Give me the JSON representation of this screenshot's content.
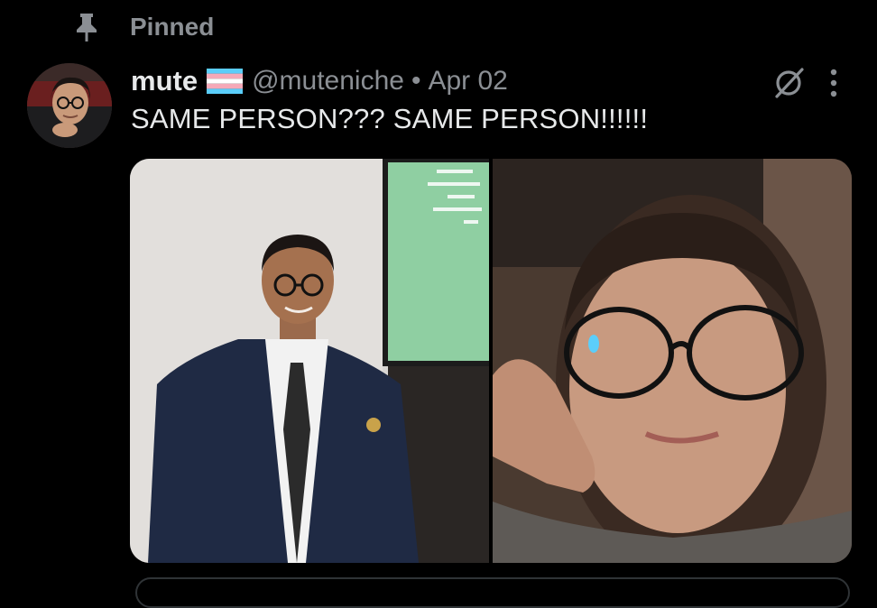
{
  "pinned": {
    "label": "Pinned",
    "icon": "pin-icon"
  },
  "tweet": {
    "author": {
      "display_name": "mute",
      "flag_icon": "transgender-flag-icon",
      "handle": "@muteniche"
    },
    "separator": "•",
    "date": "Apr 02",
    "text": "SAME PERSON??? SAME PERSON!!!!!!",
    "actions": {
      "grok_icon": "grok-icon",
      "more_icon": "more-options-icon"
    },
    "media": {
      "count": 2
    }
  },
  "colors": {
    "background": "#000000",
    "primary_text": "#e7e9ea",
    "secondary_text": "#8b8f94",
    "border": "#2f3336",
    "flag_blue": "#5bcefa",
    "flag_pink": "#f5a9b8",
    "flag_white": "#ffffff"
  }
}
